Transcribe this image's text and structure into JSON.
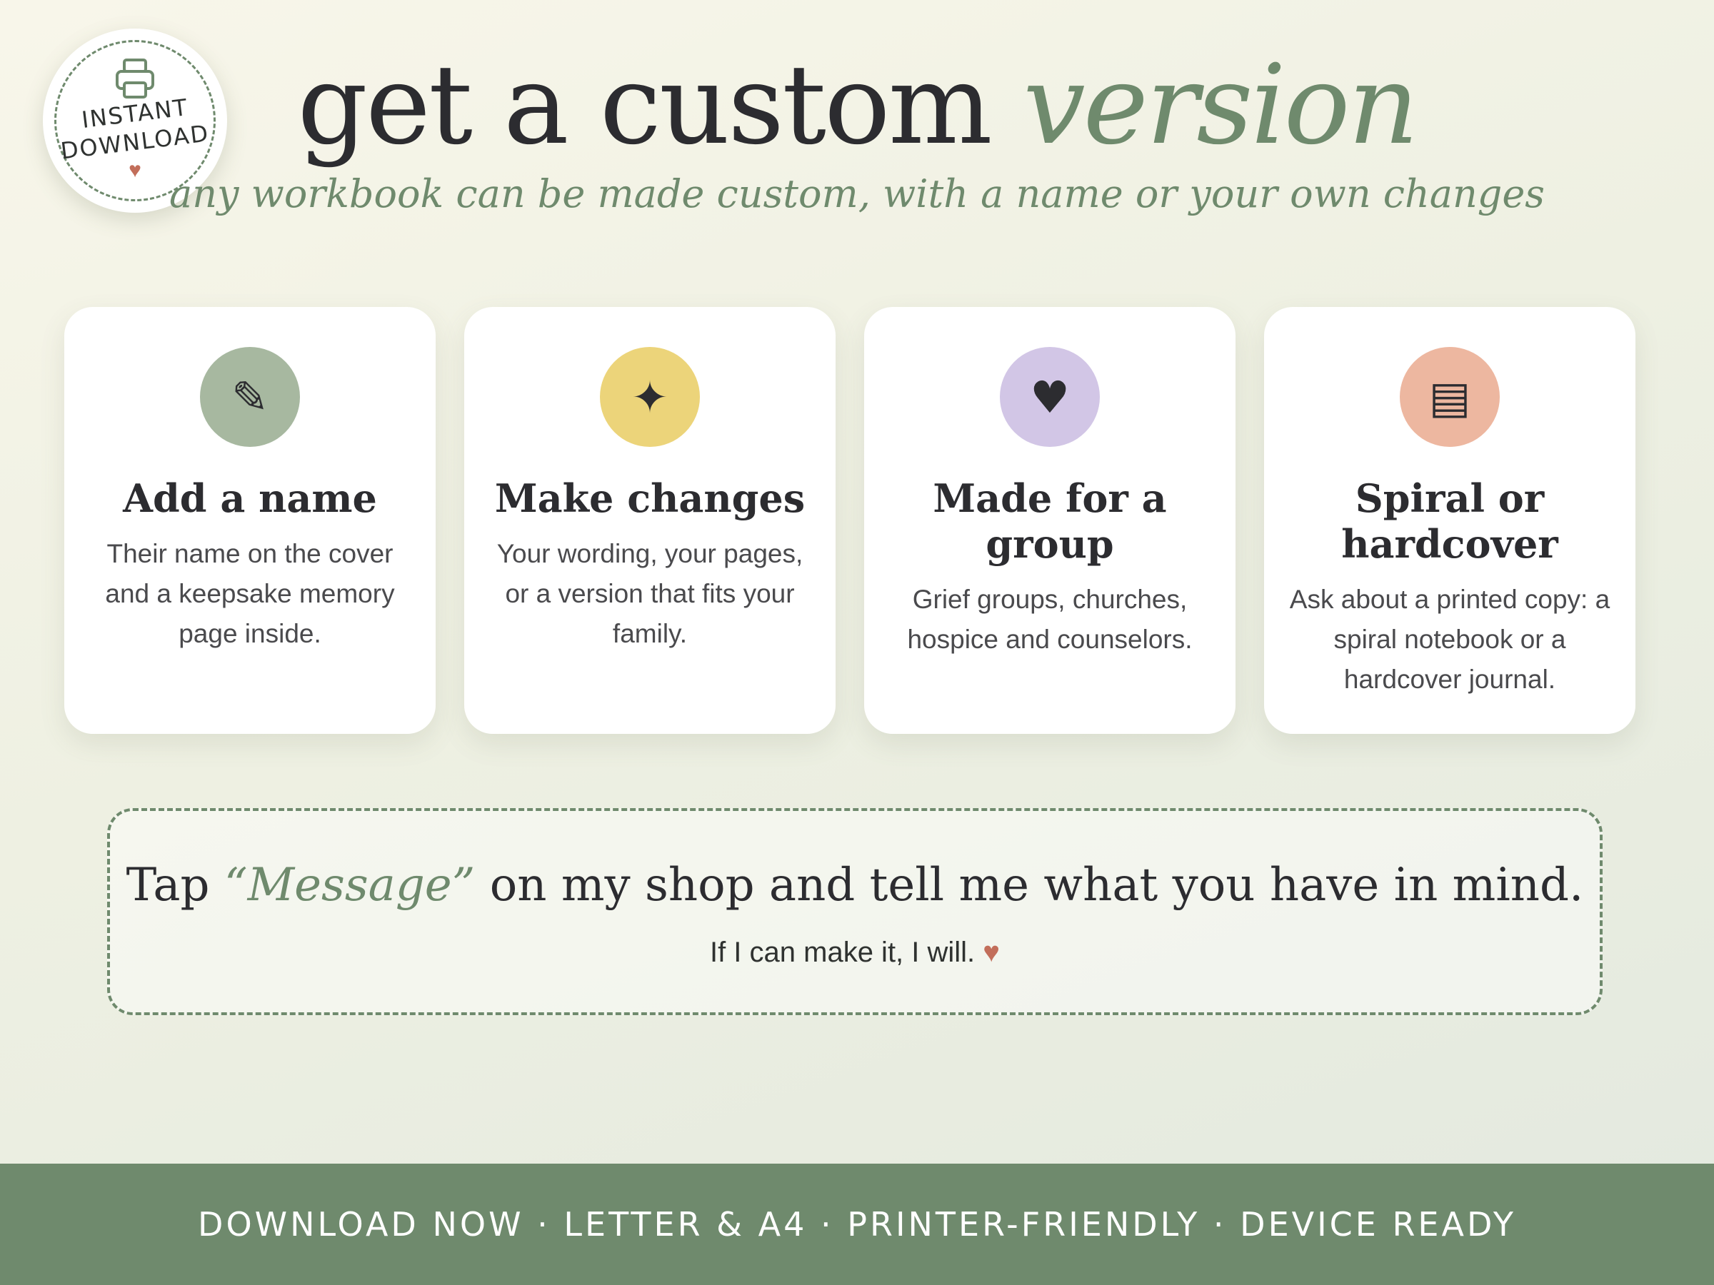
{
  "badge": {
    "icon": "printer-icon",
    "line1": "INSTANT",
    "line2": "DOWNLOAD",
    "heart": "♥"
  },
  "header": {
    "title_main": "get a custom",
    "title_accent": "version",
    "subtitle": "any workbook can be made custom, with a name or your own changes"
  },
  "cards": [
    {
      "icon": "pencil-icon",
      "glyph": "✎",
      "icon_color": "#a7b8a0",
      "title": "Add a name",
      "description": "Their name on the cover and a keepsake memory page inside."
    },
    {
      "icon": "sparkle-icon",
      "glyph": "✦",
      "icon_color": "#ecd47a",
      "title": "Make changes",
      "description": "Your wording, your pages, or a version that fits your family."
    },
    {
      "icon": "heart-icon",
      "glyph": "♥",
      "icon_color": "#d2c6e6",
      "title": "Made for a group",
      "description": "Grief groups, churches, hospice and counselors."
    },
    {
      "icon": "notebook-icon",
      "glyph": "▤",
      "icon_color": "#edb7a0",
      "title": "Spiral or hardcover",
      "description": "Ask about a printed copy: a spiral notebook or a hardcover journal."
    }
  ],
  "message": {
    "before": "Tap",
    "accent": "“Message”",
    "after": "on my shop and tell me what you have in mind.",
    "sub": "If I can make it, I will.",
    "heart": "♥"
  },
  "footer": {
    "text": "DOWNLOAD NOW · LETTER & A4 · PRINTER-FRIENDLY · DEVICE READY"
  },
  "colors": {
    "accent_green": "#6f8a6d",
    "heart": "#c26e5a",
    "text_dark": "#2c2c30"
  }
}
